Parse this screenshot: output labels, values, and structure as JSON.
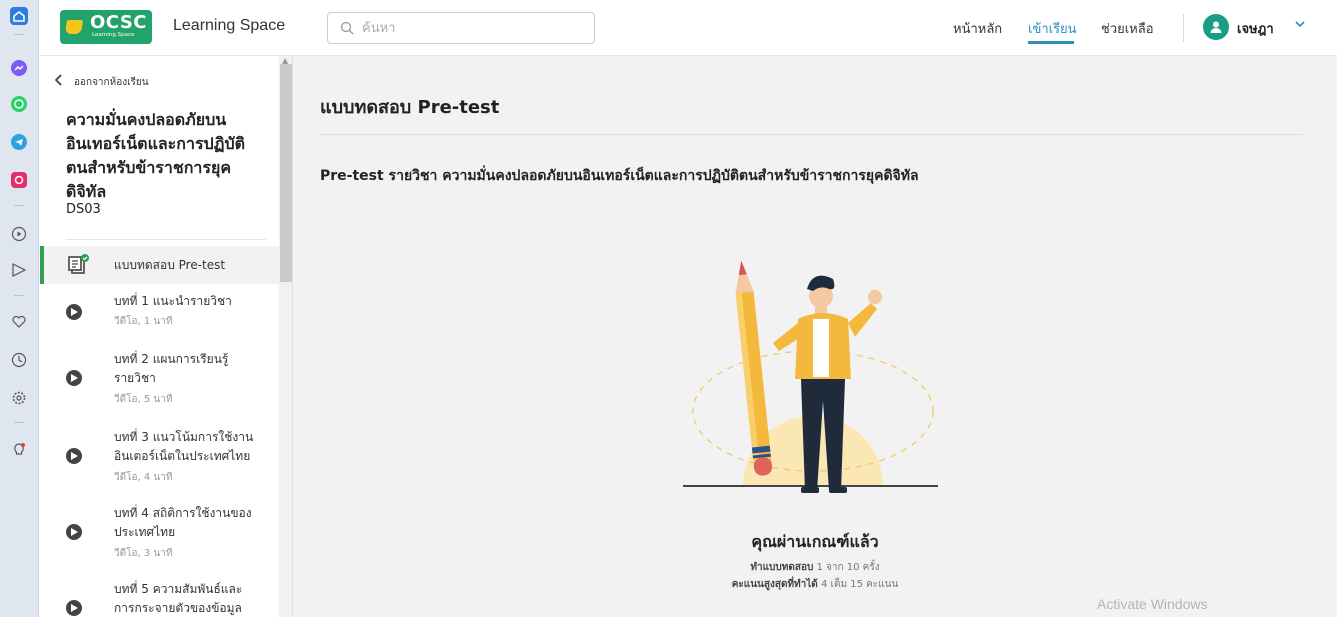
{
  "header": {
    "logo_text": "OCSC",
    "logo_sub": "Learning Space",
    "brand": "Learning Space",
    "search_placeholder": "ค้นหา",
    "nav": [
      "หน้าหลัก",
      "เข้าเรียน",
      "ช่วยเหลือ"
    ],
    "active_nav": "เข้าเรียน",
    "username": "เจษฎา"
  },
  "sidebar": {
    "back_label": "ออกจากห้องเรียน",
    "course_title": "ความมั่นคงปลอดภัยบนอินเทอร์เน็ตและการปฏิบัติตนสำหรับข้าราชการยุคดิจิทัล",
    "course_code": "DS03",
    "items": [
      {
        "title": "แบบทดสอบ Pre-test",
        "meta": ""
      },
      {
        "title": "บทที่ 1 แนะนำรายวิชา",
        "meta": "วีดีโอ, 1 นาที"
      },
      {
        "title": "บทที่ 2 แผนการเรียนรู้รายวิชา",
        "meta": "วีดีโอ, 5 นาที"
      },
      {
        "title": "บทที่ 3 แนวโน้มการใช้งานอินเตอร์เน็ตในประเทศไทย",
        "meta": "วีดีโอ, 4 นาที"
      },
      {
        "title": "บทที่ 4 สถิติการใช้งานของประเทศไทย",
        "meta": "วีดีโอ, 3 นาที"
      },
      {
        "title": "บทที่ 5 ความสัมพันธ์และการกระจายตัวของข้อมูล",
        "meta": ""
      }
    ]
  },
  "main": {
    "heading": "แบบทดสอบ Pre-test",
    "subtitle": "Pre-test รายวิชา ความมั่นคงปลอดภัยบนอินเทอร์เน็ตและการปฏิบัติตนสำหรับข้าราชการยุคดิจิทัล",
    "pass_text": "คุณผ่านเกณฑ์แล้ว",
    "attempts_label": "ทำแบบทดสอบ",
    "attempts_value": "1 จาก 10 ครั้ง",
    "score_label": "คะแนนสูงสุดที่ทำได้",
    "score_value": "4 เต็ม 15 คะแนน"
  },
  "watermark": "Activate Windows"
}
